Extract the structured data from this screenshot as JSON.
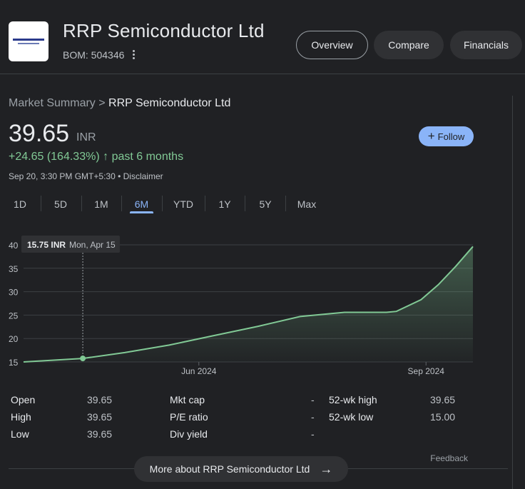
{
  "header": {
    "company_name": "RRP Semiconductor Ltd",
    "ticker": "BOM: 504346",
    "logo_text": "R.R. TRADING & AGENCIES LTD",
    "tabs": [
      {
        "label": "Overview",
        "active": true
      },
      {
        "label": "Compare",
        "active": false
      },
      {
        "label": "Financials",
        "active": false
      }
    ]
  },
  "breadcrumb": {
    "parent": "Market Summary",
    "separator": " > ",
    "current": "RRP Semiconductor Ltd"
  },
  "quote": {
    "price": "39.65",
    "currency": "INR",
    "change": "+24.65 (164.33%)",
    "change_arrow": "↑",
    "period": "past 6 months",
    "timestamp": "Sep 20, 3:30 PM GMT+5:30 • Disclaimer",
    "follow_label": "Follow",
    "change_color": "#81c995"
  },
  "ranges": [
    {
      "label": "1D",
      "active": false
    },
    {
      "label": "5D",
      "active": false
    },
    {
      "label": "1M",
      "active": false
    },
    {
      "label": "6M",
      "active": true
    },
    {
      "label": "YTD",
      "active": false
    },
    {
      "label": "1Y",
      "active": false
    },
    {
      "label": "5Y",
      "active": false
    },
    {
      "label": "Max",
      "active": false
    }
  ],
  "tooltip": {
    "value": "15.75 INR",
    "date": "Mon, Apr 15"
  },
  "chart_data": {
    "type": "area",
    "title": "",
    "xlabel": "",
    "ylabel": "",
    "x_ticks": [
      "Jun 2024",
      "Sep 2024"
    ],
    "y_ticks": [
      40,
      35,
      30,
      25,
      20,
      15
    ],
    "ylim": [
      15,
      40
    ],
    "grid": true,
    "line_color": "#81c995",
    "series": [
      {
        "x": [
          "Mar 22",
          "Apr 15",
          "May 2",
          "May 20",
          "Jun 6",
          "Jun 25",
          "Jul 12",
          "Jul 30",
          "Aug 16",
          "Aug 20",
          "Aug 30",
          "Sep 6",
          "Sep 13",
          "Sep 20"
        ],
        "values": [
          15.0,
          15.75,
          17.0,
          18.6,
          20.5,
          22.6,
          24.7,
          25.6,
          25.6,
          25.8,
          28.3,
          31.5,
          35.4,
          39.65
        ]
      }
    ]
  },
  "stats": [
    {
      "label": "Open",
      "value": "39.65"
    },
    {
      "label": "High",
      "value": "39.65"
    },
    {
      "label": "Low",
      "value": "39.65"
    },
    {
      "label": "Mkt cap",
      "value": "-"
    },
    {
      "label": "P/E ratio",
      "value": "-"
    },
    {
      "label": "Div yield",
      "value": "-"
    },
    {
      "label": "52-wk high",
      "value": "39.65"
    },
    {
      "label": "52-wk low",
      "value": "15.00"
    }
  ],
  "footer": {
    "feedback": "Feedback",
    "more_label": "More about RRP Semiconductor Ltd",
    "more_arrow": "→"
  }
}
